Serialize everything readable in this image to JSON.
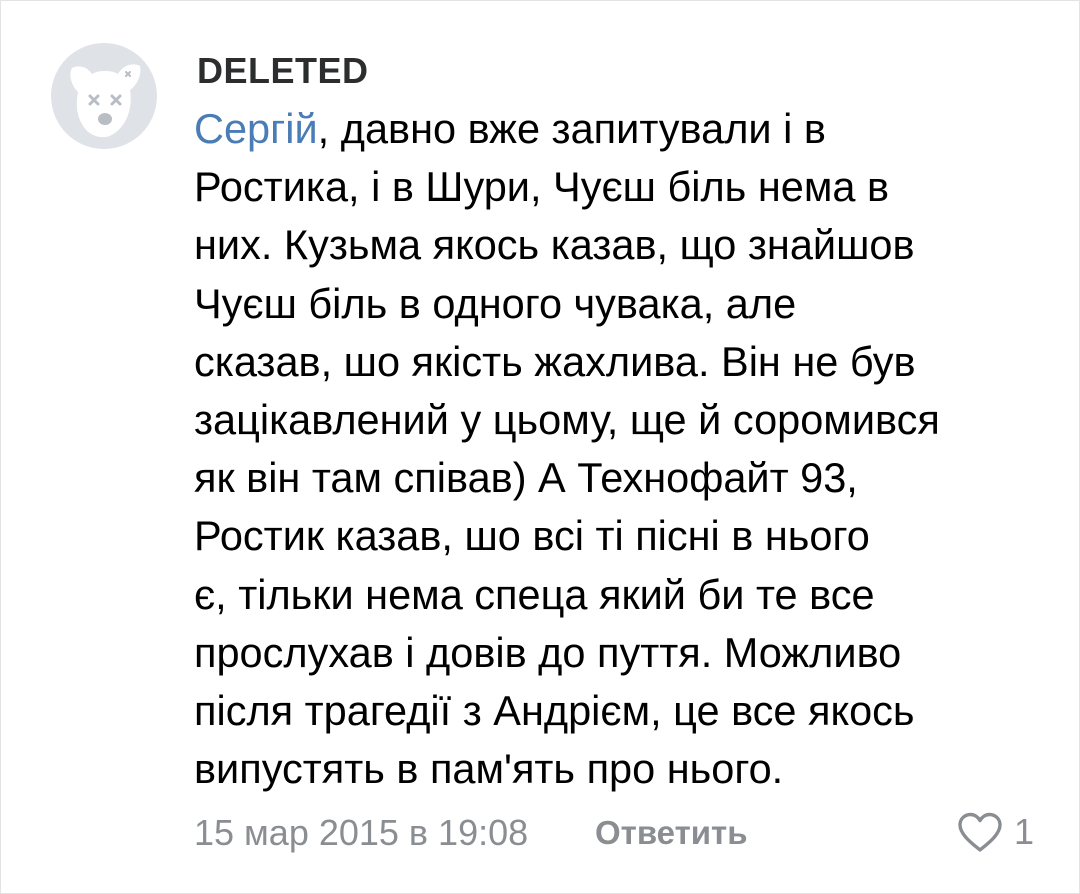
{
  "comment": {
    "author": "DELETED",
    "avatar_icon": "deleted-dog-icon",
    "mention": "Сергій",
    "text_lines": [
      ", давно вже запитували і в",
      "Ростика, і в Шури, Чуєш біль нема в",
      "них. Кузьма якось казав, що знайшов",
      "Чуєш біль в одного чувака, але",
      "сказав, шо якість жахлива. Він не був",
      "зацікавлений у цьому, ще й соромився",
      "як він там співав) А Технофайт 93,",
      "Ростик казав, шо всі ті пісні в нього",
      "є, тільки нема спеца який би те все",
      "прослухав і довів до пуття. Можливо",
      "після трагедії з Андрієм, це все якось",
      "випустять в пам'ять про нього."
    ],
    "timestamp": "15 мар 2015 в 19:08",
    "reply_label": "Ответить",
    "like_icon": "heart-outline-icon",
    "like_count": "1"
  },
  "colors": {
    "mention": "#4a7cb5",
    "meta": "#8a8d91",
    "avatar_bg": "#dfe3e8",
    "avatar_fg": "#ffffff"
  }
}
